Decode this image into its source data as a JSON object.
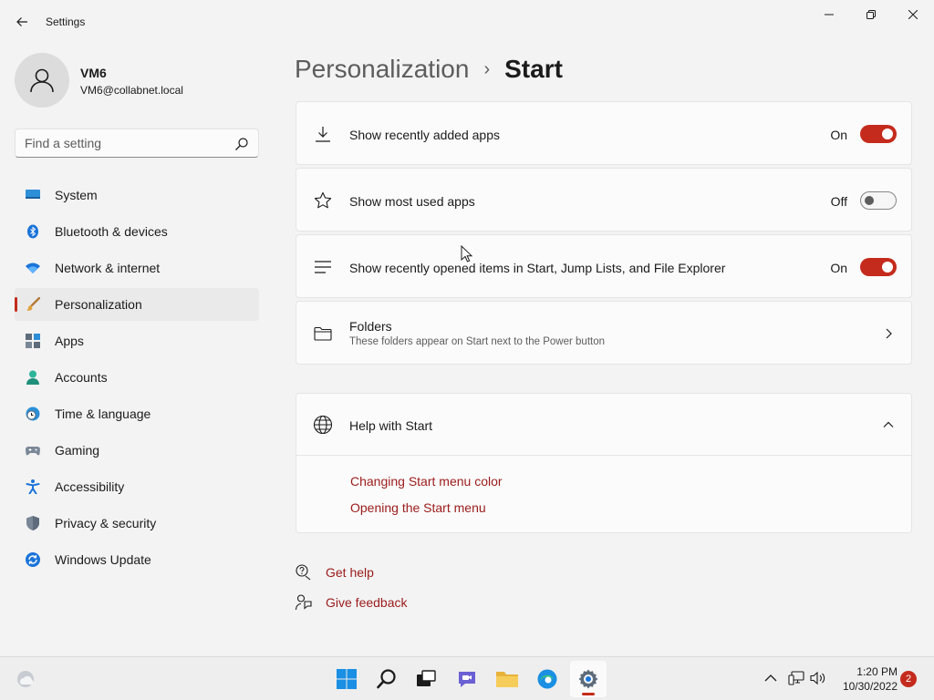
{
  "window": {
    "title": "Settings"
  },
  "user": {
    "name": "VM6",
    "email": "VM6@collabnet.local"
  },
  "search": {
    "placeholder": "Find a setting"
  },
  "sidebar": {
    "items": [
      {
        "label": "System"
      },
      {
        "label": "Bluetooth & devices"
      },
      {
        "label": "Network & internet"
      },
      {
        "label": "Personalization",
        "active": true
      },
      {
        "label": "Apps"
      },
      {
        "label": "Accounts"
      },
      {
        "label": "Time & language"
      },
      {
        "label": "Gaming"
      },
      {
        "label": "Accessibility"
      },
      {
        "label": "Privacy & security"
      },
      {
        "label": "Windows Update"
      }
    ]
  },
  "breadcrumb": {
    "parent": "Personalization",
    "separator": "›",
    "current": "Start"
  },
  "settings": {
    "recently_added": {
      "label": "Show recently added apps",
      "state": "On"
    },
    "most_used": {
      "label": "Show most used apps",
      "state": "Off"
    },
    "recently_opened": {
      "label": "Show recently opened items in Start, Jump Lists, and File Explorer",
      "state": "On"
    },
    "folders": {
      "label": "Folders",
      "description": "These folders appear on Start next to the Power button"
    }
  },
  "help": {
    "title": "Help with Start",
    "links": [
      "Changing Start menu color",
      "Opening the Start menu"
    ]
  },
  "footer_links": {
    "get_help": "Get help",
    "give_feedback": "Give feedback"
  },
  "taskbar": {
    "time": "1:20 PM",
    "date": "10/30/2022",
    "notification_count": "2"
  },
  "colors": {
    "accent": "#c42b1c",
    "link": "#9b1b1b"
  }
}
